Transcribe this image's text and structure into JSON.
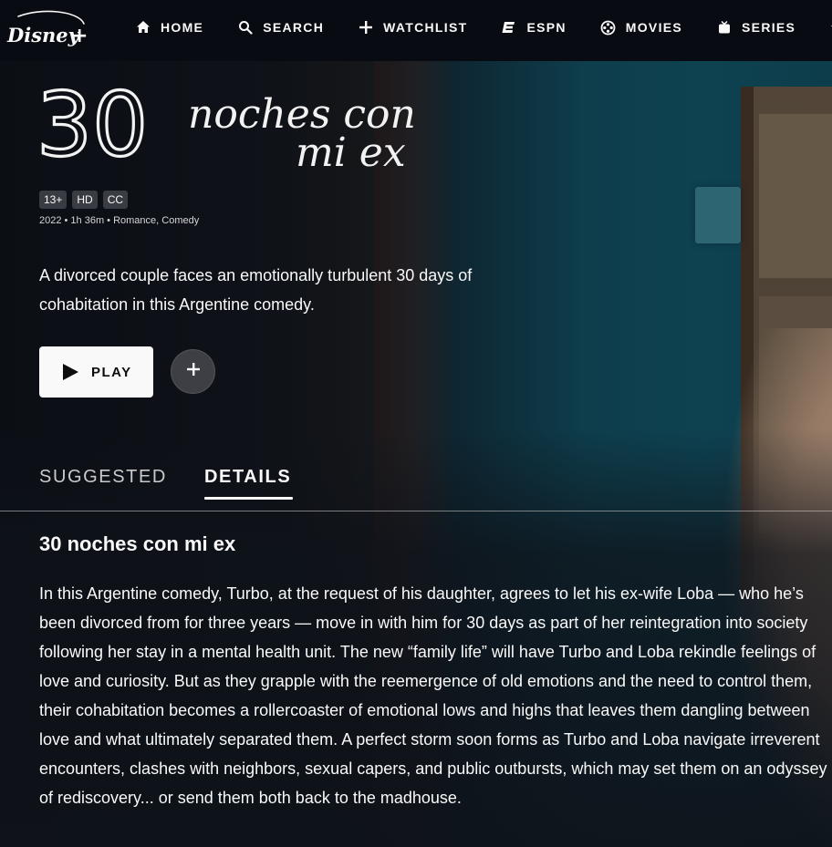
{
  "app": {
    "brand": "Disney+",
    "colors": {
      "nav_bg": "#090b13",
      "text": "#f9f9f9",
      "badge_bg": "#3a3c43",
      "play_bg": "#f9f9f9"
    }
  },
  "nav": {
    "items": [
      {
        "label": "HOME",
        "icon": "home-icon"
      },
      {
        "label": "SEARCH",
        "icon": "search-icon"
      },
      {
        "label": "WATCHLIST",
        "icon": "plus-icon"
      },
      {
        "label": "ESPN",
        "icon": "espn-icon"
      },
      {
        "label": "MOVIES",
        "icon": "movie-reel-icon"
      },
      {
        "label": "SERIES",
        "icon": "tv-icon"
      },
      {
        "label": "",
        "icon": "star-icon"
      }
    ]
  },
  "hero": {
    "title_art_lines": [
      "30",
      "noches con",
      "mi ex"
    ],
    "badges": [
      "13+",
      "HD",
      "CC"
    ],
    "meta": "2022 • 1h 36m • Romance, Comedy",
    "description": "A divorced couple faces an emotionally turbulent 30 days of cohabitation in this Argentine comedy.",
    "play_label": "PLAY",
    "add_icon": "plus-icon"
  },
  "tabs": [
    {
      "label": "SUGGESTED",
      "active": false
    },
    {
      "label": "DETAILS",
      "active": true
    }
  ],
  "details": {
    "title": "30 noches con mi ex",
    "body": "In this Argentine comedy, Turbo, at the request of his daughter, agrees to let his ex-wife Loba — who he’s been divorced from for three years — move in with him for 30 days as part of her reintegration into society following her stay in a mental health unit. The new “family life” will have Turbo and Loba rekindle feelings of love and curiosity. But as they grapple with the reemergence of old emotions and the need to control them, their cohabitation becomes a rollercoaster of emotional lows and highs that leaves them dangling between love and what ultimately separated them. A perfect storm soon forms as Turbo and Loba navigate irreverent encounters, clashes with neighbors, sexual capers, and public outbursts, which may set them on an odyssey of rediscovery... or send them both back to the madhouse."
  }
}
